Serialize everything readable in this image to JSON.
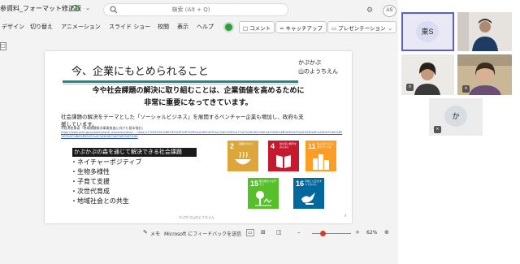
{
  "app": {
    "doc_title": "参資料_フォーマット修正版",
    "search_placeholder": "検索 (Alt + Q)",
    "user_initials": "AS"
  },
  "ribbon": {
    "menus": [
      "デザイン",
      "切り替え",
      "アニメーション",
      "スライド ショー",
      "校閲",
      "表示",
      "ヘルプ"
    ],
    "comment_label": "コメント",
    "catchup_label": "キャッチアップ",
    "present_label": "プレゼンテーション"
  },
  "slide": {
    "title": "今、企業にもとめられること",
    "logo_line1": "かぷかぷ",
    "logo_line2": "山のようちえん",
    "headline1": "今や社会課題の解決に取り組むことは、企業価値を高めるために",
    "headline2": "非常に重要になってきています。",
    "body1": "社会課題の解決をテーマとした「ソーシャルビジネス」を展開するベンチャー企業も増加し、政府も支",
    "body2": "援しています。",
    "note": "※経済産業省「地域課題解決事業推進に向けた基本指針」",
    "link1": "https://www.meti.go.jp/policy/local_economy/sbcb/ -- https://ミ%E5%9C%B0%E5%9F%9F%E8%AA%B2%E9%A1%8C%E8%A7%A3%E6%B1%BA%E4%BA%8B%E6%A5%AD%E6%8E%A8%E9%80%B2",
    "link2": "%E5%9F%BA%E6%9C%AC%E6%8C%87%E9%87%9D",
    "band": "かぷかぷの森を通じて解決できる社会課題",
    "bullets": [
      "・ネイチャーポジティブ",
      "・生物多様性",
      "・子育て支援",
      "・次世代育成",
      "・地域社会との共生"
    ],
    "footer": "かぷかぷ山のようちえん",
    "page_number": "4",
    "sdgs": [
      {
        "num": "2",
        "cap": "飢餓をゼロに",
        "color": "#dda63a"
      },
      {
        "num": "4",
        "cap": "質の高い教育をみんなに",
        "color": "#c5192d"
      },
      {
        "num": "11",
        "cap": "住み続けられるまちづくりを",
        "color": "#fd9d24"
      },
      {
        "num": "15",
        "cap": "陸の豊かさも守ろう",
        "color": "#56c02b"
      },
      {
        "num": "16",
        "cap": "平和と公正をすべての人に",
        "color": "#00689d"
      }
    ]
  },
  "statusbar": {
    "notes_label": "メモ",
    "feedback_label": "Microsoft にフィードバックを送信",
    "zoom_level": "62%"
  },
  "meeting": {
    "participant1_initials": "東S",
    "participant2_initials": "か"
  },
  "colors": {
    "teal": "#1b8a8a",
    "teams_accent": "#5b5fc7",
    "record_green": "#2e9b3c",
    "zoom_red": "#d43a2f"
  }
}
